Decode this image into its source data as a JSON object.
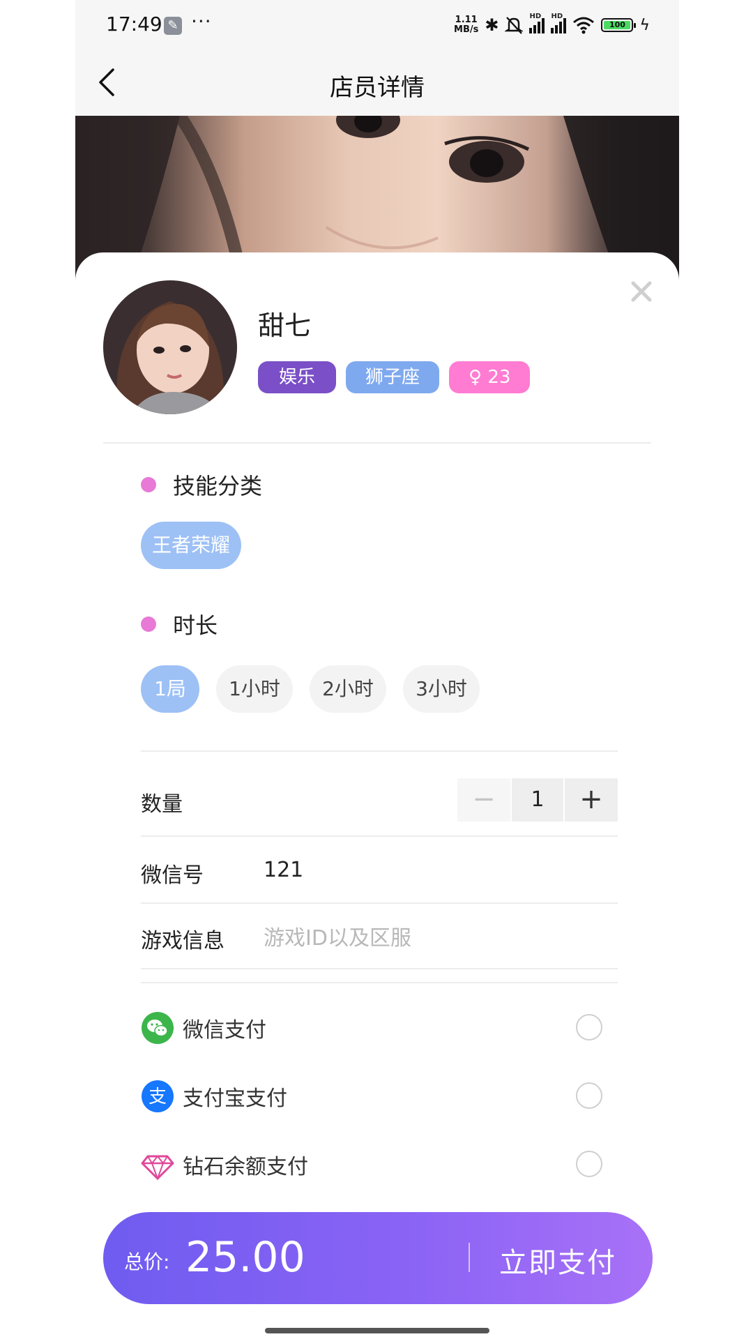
{
  "status_bar": {
    "time": "17:49",
    "more": "···",
    "net_speed_value": "1.11",
    "net_speed_unit": "MB/s",
    "signal_tag": "HD",
    "battery": "100"
  },
  "header": {
    "title": "店员详情"
  },
  "profile": {
    "name": "甜七",
    "tags": [
      "娱乐",
      "狮子座",
      "♀ 23"
    ]
  },
  "skill": {
    "title": "技能分类",
    "selected": "王者荣耀"
  },
  "duration": {
    "title": "时长",
    "options": [
      "1局",
      "1小时",
      "2小时",
      "3小时"
    ],
    "selected_index": 0
  },
  "form": {
    "quantity_label": "数量",
    "quantity_minus": "−",
    "quantity_value": "1",
    "quantity_plus": "+",
    "wechat_label": "微信号",
    "wechat_value": "121",
    "game_label": "游戏信息",
    "game_placeholder": "游戏ID以及区服"
  },
  "payment": {
    "methods": [
      "微信支付",
      "支付宝支付",
      "钻石余额支付"
    ]
  },
  "checkout": {
    "total_label": "总价:",
    "total_amount": "25.00",
    "pay_button": "立即支付"
  },
  "colors": {
    "accent_purple": "#7a4fc7",
    "tag_blue": "#7fa9ef",
    "tag_pink": "#ff7cd2",
    "chip_selected": "#9dc0f5",
    "section_dot": "#e879d6",
    "pay_gradient_start": "#6f5cf0",
    "pay_gradient_end": "#a871f7"
  }
}
